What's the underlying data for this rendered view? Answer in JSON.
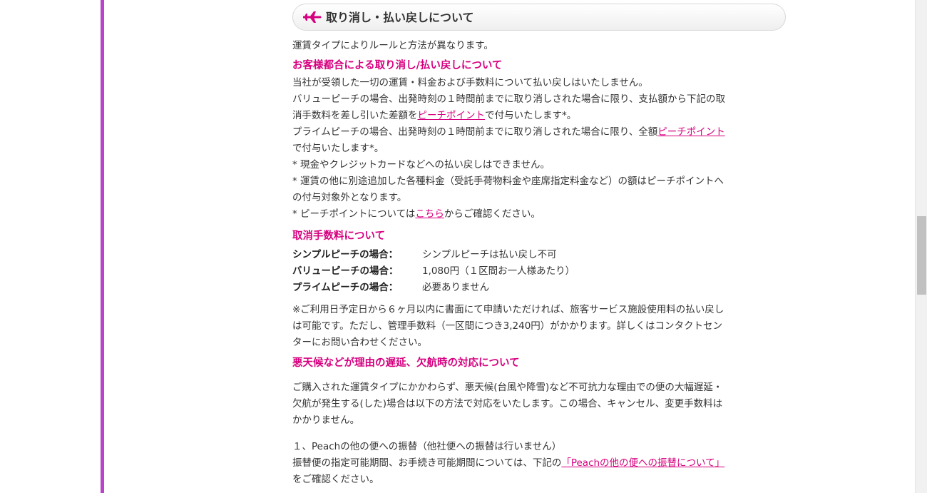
{
  "section": {
    "title": "取り消し・払い戻しについて"
  },
  "intro": "運賃タイプによりルールと方法が異なります。",
  "customer_cancel": {
    "heading": "お客様都合による取り消し/払い戻しについて",
    "line1": "当社が受領した一切の運賃・料金および手数料について払い戻しはいたしません。",
    "value_a": "バリューピーチの場合、出発時刻の１時間前までに取り消しされた場合に限り、支払額から下記の取",
    "value_b": "消手数料を差し引いた差額を",
    "value_link": "ピーチポイント",
    "value_c": "で付与いたします*。",
    "prime_a": "プライムピーチの場合、出発時刻の１時間前までに取り消しされた場合に限り、全額",
    "prime_link": "ピーチポイント",
    "prime_b": "で付与いたします*。",
    "note1": "* 現金やクレジットカードなどへの払い戻しはできません。",
    "note2a": "* 運賃の他に別途追加した各種料金（受託手荷物料金や座席指定料金など）の額はピーチポイントへ",
    "note2b": "の付与対象外となります。",
    "note3a": "* ピーチポイントについては",
    "note3_link": "こちら",
    "note3b": "からご確認ください。"
  },
  "fees": {
    "heading": "取消手数料について",
    "rows": [
      {
        "label": "シンプルピーチの場合：",
        "value": "シンプルピーチは払い戻し不可"
      },
      {
        "label": "バリューピーチの場合：",
        "value": "1,080円（１区間お一人様あたり）"
      },
      {
        "label": "プライムピーチの場合：",
        "value": "必要ありません"
      }
    ],
    "note_a": "※ご利用日予定日から６ヶ月以内に書面にて申請いただければ、旅客サービス施設使用料の払い戻し",
    "note_b": "は可能です。ただし、管理手数料（一区間につき3,240円）がかかります。詳しくはコンタクトセン",
    "note_c": "ターにお問い合わせください。"
  },
  "weather": {
    "heading": "悪天候などが理由の遅延、欠航時の対応について",
    "para_a": "ご購入された運賃タイプにかかわらず、悪天候(台風や降雪)など不可抗力な理由での便の大幅遅延・",
    "para_b": "欠航が発生する(した)場合は以下の方法で対応をいたします。この場合、キャンセル、変更手数料は",
    "para_c": "かかりません。",
    "item1": "１、Peachの他の便への振替（他社便への振替は行いません）",
    "item1_desc_a": "振替便の指定可能期間、お手続き可能期間については、下記の",
    "item1_link": "「Peachの他の便への振替について」",
    "item1_desc_b": "をご確認ください。"
  },
  "colors": {
    "accent": "#d6007f",
    "left_bar": "#b845c9"
  },
  "icons": {
    "section": "plane-icon"
  }
}
